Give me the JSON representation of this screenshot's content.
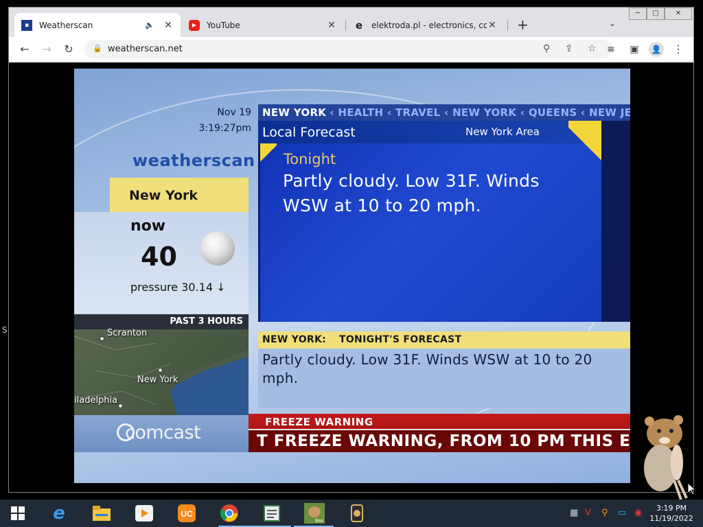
{
  "browser": {
    "tabs": [
      {
        "title": "Weatherscan",
        "active": true,
        "favicon": "weather-channel-icon"
      },
      {
        "title": "YouTube",
        "active": false,
        "favicon": "youtube-icon"
      },
      {
        "title": "elektroda.pl - electronics, compu",
        "active": false,
        "favicon": "elektroda-icon"
      }
    ],
    "url": "weatherscan.net",
    "window_buttons": {
      "minimize": "─",
      "maximize": "□",
      "close": "✕"
    }
  },
  "weatherscan": {
    "date": "Nov 19",
    "time": "3:19:27pm",
    "logo": "weatherscan",
    "location": "New York",
    "now_label": "now",
    "temperature": "40",
    "pressure": "pressure 30.14 ↓",
    "map_header": "PAST 3 HOURS",
    "map_cities": {
      "scranton": "Scranton",
      "newyork": "New York",
      "philadelphia": "iladelphia"
    },
    "sponsor": "comcast",
    "nav": {
      "current": "NEW YORK",
      "items": [
        "HEALTH",
        "TRAVEL",
        "NEW YORK",
        "QUEENS",
        "NEW JE"
      ]
    },
    "panel_title": "Local Forecast",
    "panel_area": "New York Area",
    "forecast_period": "Tonight",
    "forecast_text": "Partly cloudy. Low 31F. Winds WSW at 10 to 20 mph.",
    "tonight_bar": {
      "location": "NEW YORK:",
      "title": "TONIGHT'S FORECAST"
    },
    "tonight_text": "Partly cloudy. Low 31F. Winds WSW at 10 to 20 mph.",
    "warning_label": "FREEZE WARNING",
    "warning_scroll": "T FREEZE WARNING, FROM 10 PM THIS EV"
  },
  "taskbar": {
    "time": "3:19 PM",
    "date": "11/19/2022",
    "apps": [
      "start-icon",
      "internet-explorer-icon",
      "file-explorer-icon",
      "media-player-icon",
      "uc-browser-icon",
      "chrome-icon",
      "notepad-icon",
      "box-app-icon",
      "game-icon"
    ]
  },
  "desktop": {
    "side_text": "S"
  },
  "colors": {
    "accent_blue": "#24439a",
    "warning_red": "#c21a1a",
    "yellow": "#f0df7a"
  }
}
